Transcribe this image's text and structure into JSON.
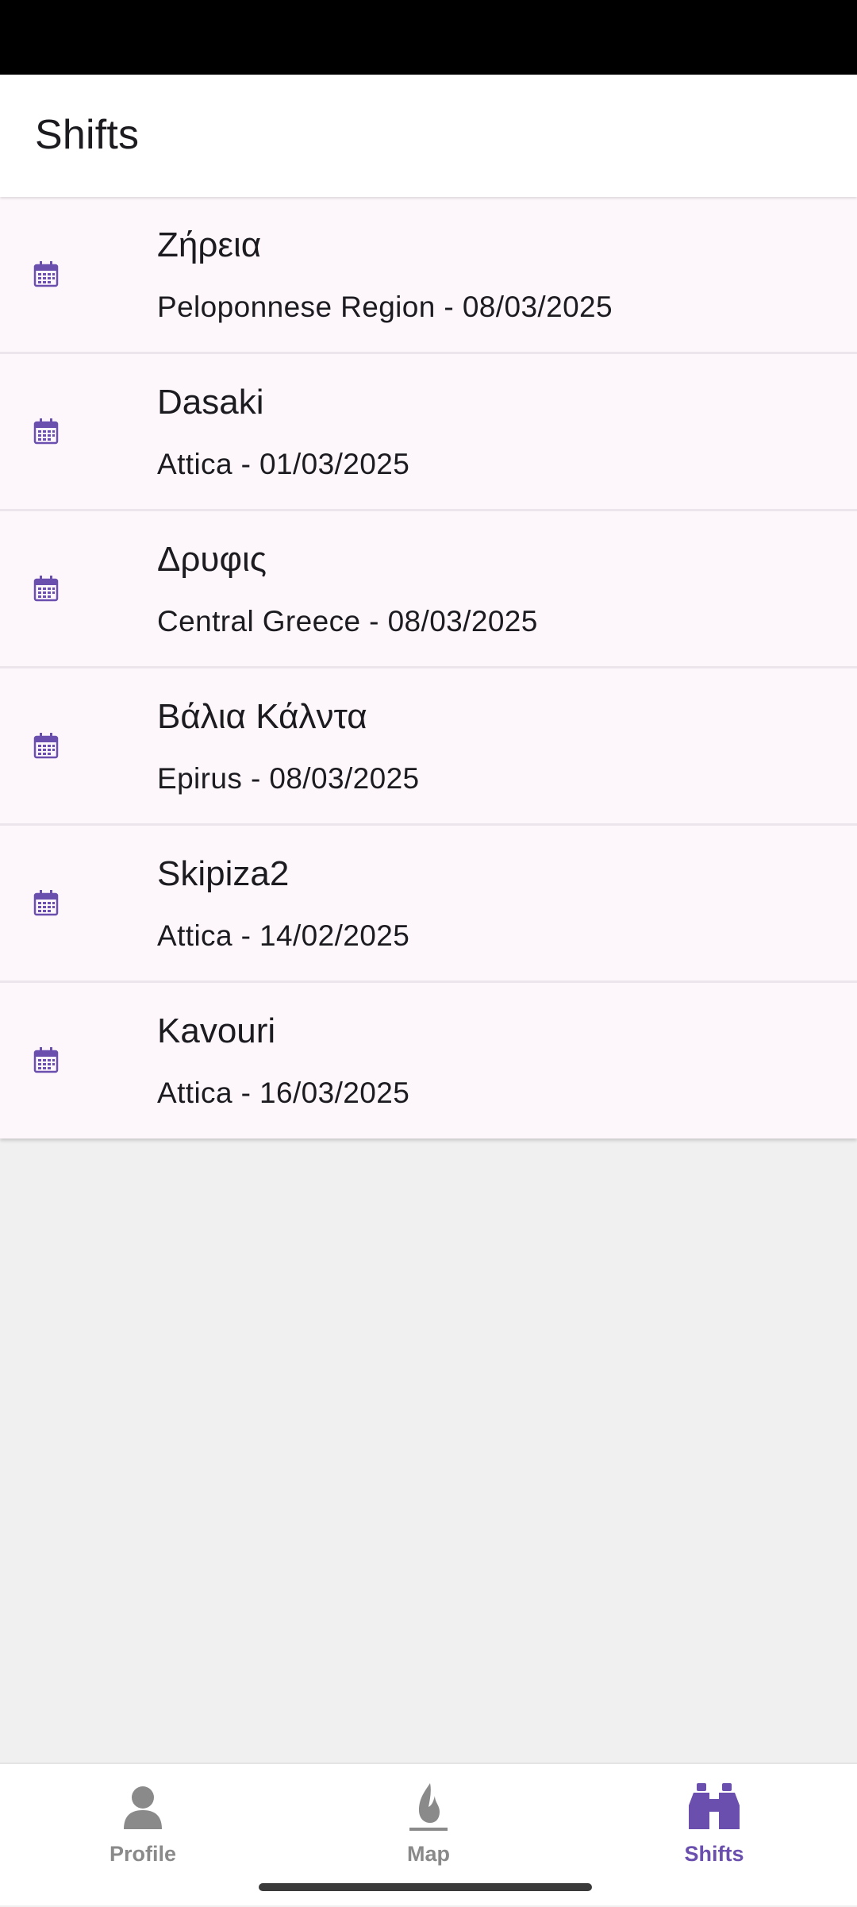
{
  "app_bar": {
    "title": "Shifts"
  },
  "shifts": [
    {
      "name": "Ζήρεια",
      "subtitle": "Peloponnese Region - 08/03/2025",
      "icon": "calendar-icon"
    },
    {
      "name": "Dasaki",
      "subtitle": "Attica - 01/03/2025",
      "icon": "calendar-icon"
    },
    {
      "name": "Δρυφις",
      "subtitle": "Central Greece - 08/03/2025",
      "icon": "calendar-icon"
    },
    {
      "name": "Βάλια Κάλντα",
      "subtitle": "Epirus - 08/03/2025",
      "icon": "calendar-icon"
    },
    {
      "name": "Skipiza2",
      "subtitle": "Attica - 14/02/2025",
      "icon": "calendar-icon"
    },
    {
      "name": "Kavouri",
      "subtitle": "Attica - 16/03/2025",
      "icon": "calendar-icon"
    }
  ],
  "bottom_nav": {
    "items": [
      {
        "label": "Profile",
        "icon": "person-icon",
        "active": false
      },
      {
        "label": "Map",
        "icon": "fire-icon",
        "active": false
      },
      {
        "label": "Shifts",
        "icon": "binoculars-icon",
        "active": true
      }
    ]
  },
  "colors": {
    "accent": "#6a4fae",
    "inactive": "#8a8a8a",
    "list_background": "#fdf7fc",
    "page_background": "#f0f0f0"
  }
}
